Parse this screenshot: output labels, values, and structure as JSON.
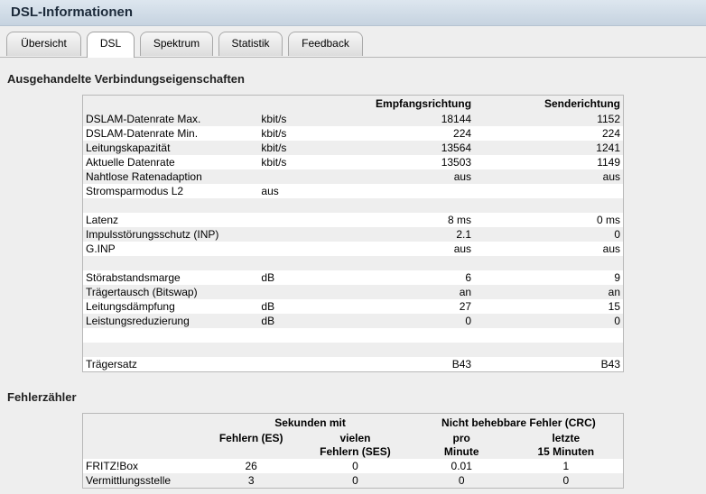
{
  "window": {
    "title": "DSL-Informationen"
  },
  "tabs": [
    {
      "label": "Übersicht"
    },
    {
      "label": "DSL"
    },
    {
      "label": "Spektrum"
    },
    {
      "label": "Statistik"
    },
    {
      "label": "Feedback"
    }
  ],
  "active_tab": "DSL",
  "section1": {
    "title": "Ausgehandelte Verbindungseigenschaften",
    "headers": [
      "",
      "",
      "Empfangsrichtung",
      "Senderichtung"
    ],
    "rows": [
      [
        "DSLAM-Datenrate Max.",
        "kbit/s",
        "18144",
        "1152"
      ],
      [
        "DSLAM-Datenrate Min.",
        "kbit/s",
        "224",
        "224"
      ],
      [
        "Leitungskapazität",
        "kbit/s",
        "13564",
        "1241"
      ],
      [
        "Aktuelle Datenrate",
        "kbit/s",
        "13503",
        "1149"
      ],
      [
        "Nahtlose Ratenadaption",
        "",
        "aus",
        "aus"
      ],
      [
        "Stromsparmodus L2",
        "aus",
        "",
        ""
      ],
      [
        "",
        "",
        "",
        ""
      ],
      [
        "Latenz",
        "",
        "8 ms",
        "0 ms"
      ],
      [
        "Impulsstörungsschutz (INP)",
        "",
        "2.1",
        "0"
      ],
      [
        "G.INP",
        "",
        "aus",
        "aus"
      ],
      [
        "",
        "",
        "",
        ""
      ],
      [
        "Störabstandsmarge",
        "dB",
        "6",
        "9"
      ],
      [
        "Trägertausch (Bitswap)",
        "",
        "an",
        "an"
      ],
      [
        "Leitungsdämpfung",
        "dB",
        "27",
        "15"
      ],
      [
        "Leistungsreduzierung",
        "dB",
        "0",
        "0"
      ],
      [
        "",
        "",
        "",
        ""
      ],
      [
        "",
        "",
        "",
        ""
      ],
      [
        "Trägersatz",
        "",
        "B43",
        "B43"
      ]
    ]
  },
  "section2": {
    "title": "Fehlerzähler",
    "group_headers": [
      "Sekunden mit",
      "Nicht behebbare Fehler (CRC)"
    ],
    "sub_headers": [
      "Fehlern (ES)",
      "vielen",
      "Fehlern (SES)",
      "pro",
      "Minute",
      "letzte",
      "15 Minuten"
    ],
    "rows": [
      [
        "FRITZ!Box",
        "26",
        "0",
        "0.01",
        "1"
      ],
      [
        "Vermittlungsstelle",
        "3",
        "0",
        "0",
        "0"
      ]
    ]
  }
}
